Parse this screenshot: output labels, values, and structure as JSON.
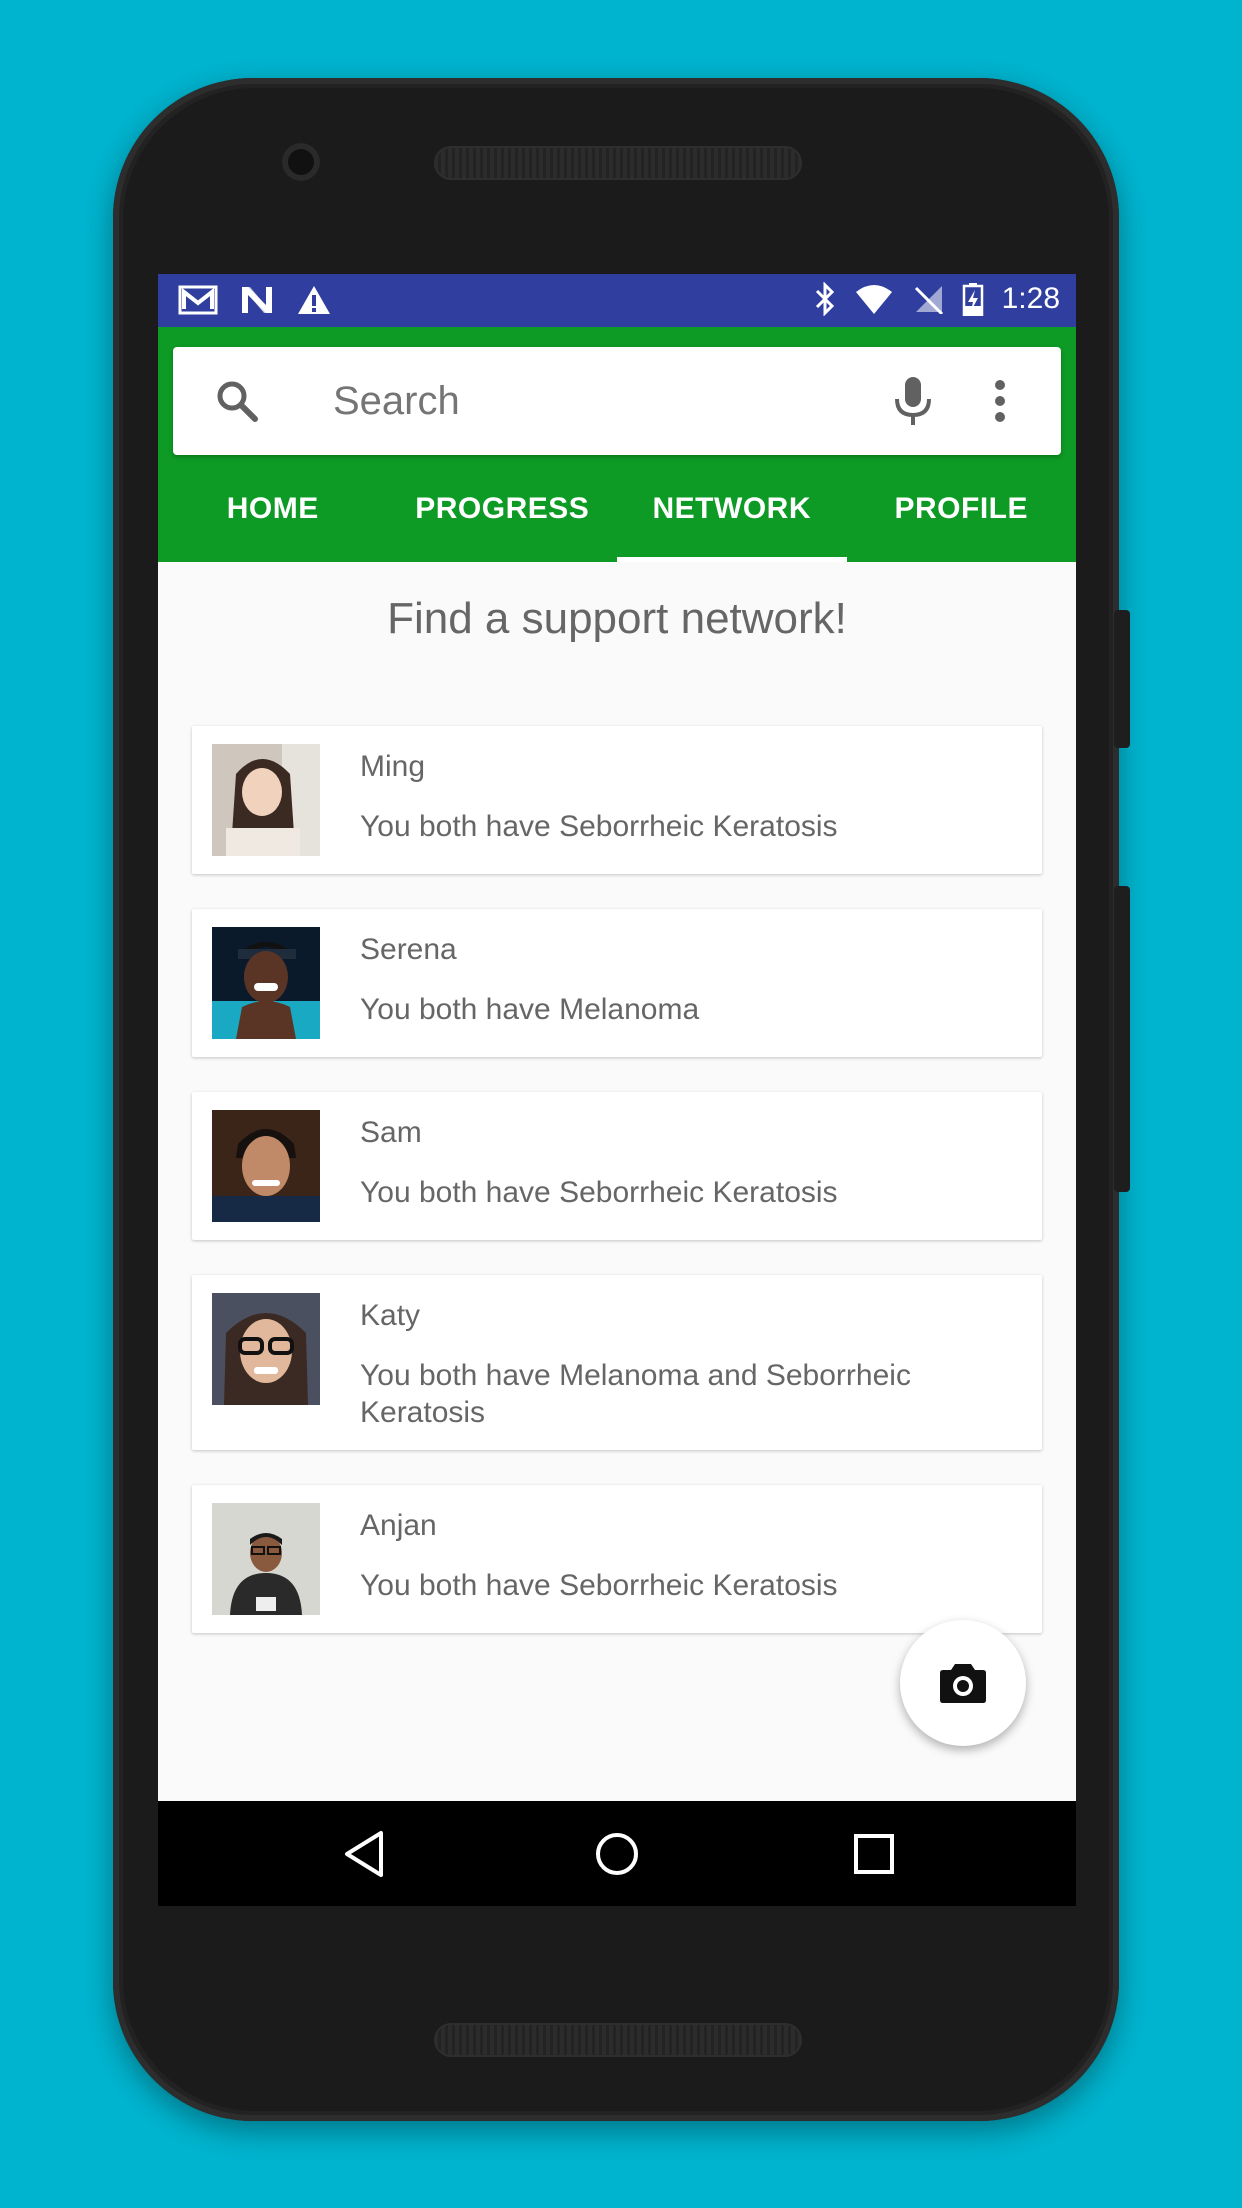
{
  "status_bar": {
    "time": "1:28",
    "left_icons": [
      "gmail-icon",
      "n-icon",
      "warning-icon"
    ],
    "right_icons": [
      "bluetooth-icon",
      "wifi-icon",
      "no-signal-icon",
      "battery-charging-icon"
    ]
  },
  "colors": {
    "status_bar": "#303F9F",
    "header": "#0D9B25",
    "background": "#00B4CF"
  },
  "search": {
    "placeholder": "Search",
    "icons": [
      "search-icon",
      "mic-icon",
      "more-vert-icon"
    ]
  },
  "tabs": [
    {
      "label": "HOME",
      "active": false
    },
    {
      "label": "PROGRESS",
      "active": false
    },
    {
      "label": "NETWORK",
      "active": true
    },
    {
      "label": "PROFILE",
      "active": false
    }
  ],
  "content": {
    "title": "Find a support network!"
  },
  "network": [
    {
      "name": "Ming",
      "description": "You both have Seborrheic Keratosis"
    },
    {
      "name": "Serena",
      "description": "You both have Melanoma"
    },
    {
      "name": "Sam",
      "description": "You both have Seborrheic Keratosis"
    },
    {
      "name": "Katy",
      "description": "You both have Melanoma and Seborrheic Keratosis"
    },
    {
      "name": "Anjan",
      "description": "You both have Seborrheic Keratosis"
    }
  ],
  "fab": {
    "icon": "camera-icon"
  },
  "nav": {
    "icons": [
      "back-icon",
      "home-icon",
      "recents-icon"
    ]
  }
}
